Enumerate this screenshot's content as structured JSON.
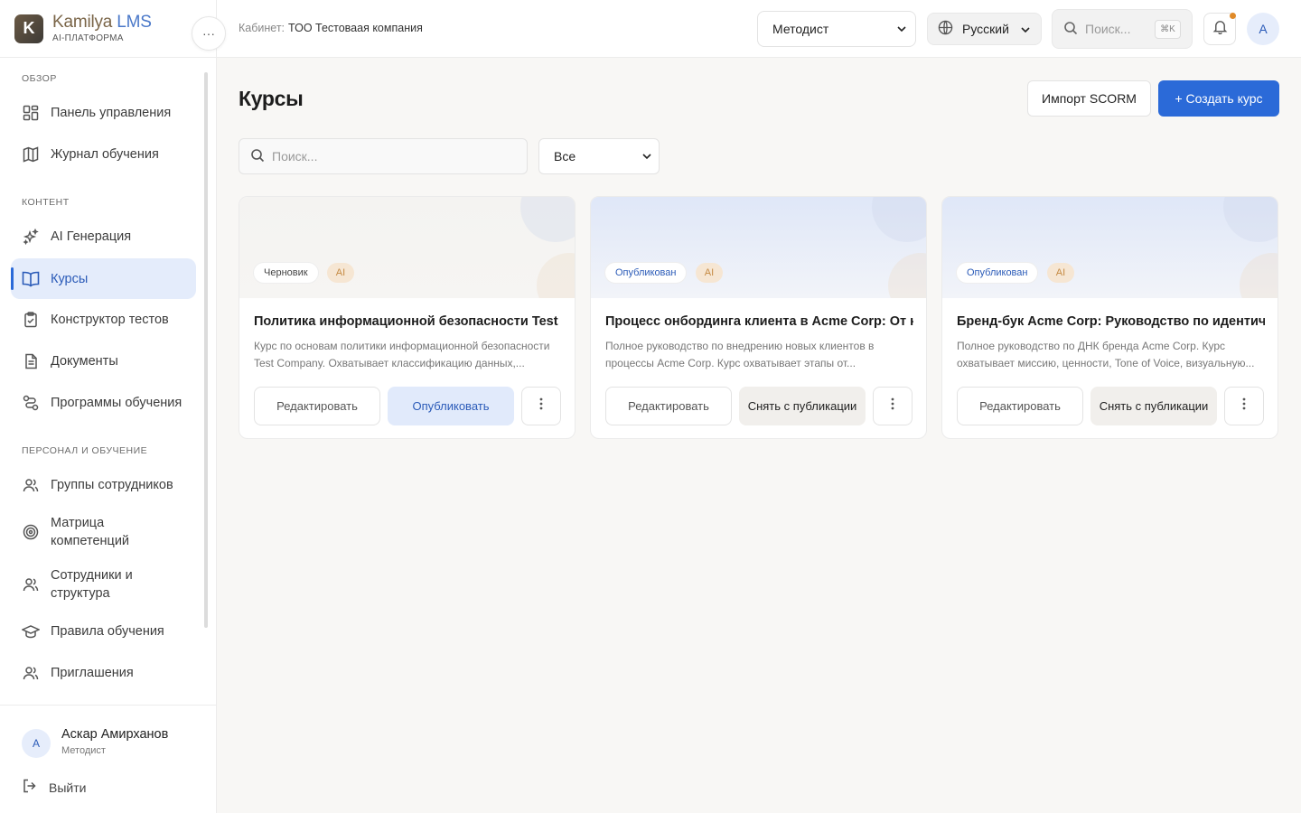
{
  "brand": {
    "logo_letter": "K",
    "name_part1": "Kamilya",
    "name_part2": " LMS",
    "subtitle": "AI-ПЛАТФОРМА"
  },
  "sidebar": {
    "sections": [
      {
        "label": "ОБЗОР"
      },
      {
        "label": "КОНТЕНТ"
      },
      {
        "label": "ПЕРСОНАЛ И ОБУЧЕНИЕ"
      }
    ],
    "items": [
      {
        "label": "Панель управления",
        "icon": "dashboard-icon"
      },
      {
        "label": "Журнал обучения",
        "icon": "map-icon"
      },
      {
        "label": "AI Генерация",
        "icon": "sparkles-icon"
      },
      {
        "label": "Курсы",
        "icon": "book-icon",
        "active": true
      },
      {
        "label": "Конструктор тестов",
        "icon": "clipboard-icon"
      },
      {
        "label": "Документы",
        "icon": "document-icon"
      },
      {
        "label": "Программы обучения",
        "icon": "route-icon"
      },
      {
        "label": "Группы сотрудников",
        "icon": "users-icon"
      },
      {
        "label": "Матрица компетенций",
        "icon": "target-icon"
      },
      {
        "label": "Сотрудники и структура",
        "icon": "users-icon"
      },
      {
        "label": "Правила обучения",
        "icon": "graduation-cap-icon"
      },
      {
        "label": "Приглашения",
        "icon": "users-icon"
      }
    ],
    "more_glyph": "···"
  },
  "user": {
    "initial": "А",
    "name": "Аскар Амирханов",
    "role": "Методист",
    "logout": "Выйти"
  },
  "header": {
    "cabinet_label": "Кабинет:",
    "cabinet_value": "ТОО Тестоваая компания",
    "role": "Методист",
    "language": "Русский",
    "search_placeholder": "Поиск...",
    "shortcut": "⌘K",
    "avatar_initial": "А",
    "notification_dot_color": "#e08a28"
  },
  "main": {
    "title": "Курсы",
    "import_button": "Импорт SCORM",
    "create_button": "+ Создать курс",
    "search_placeholder": "Поиск...",
    "filter_value": "Все"
  },
  "courses": [
    {
      "status": "Черновик",
      "ai_badge": "AI",
      "title": "Политика информационной безопасности Test C",
      "description": "Курс по основам политики информационной безопасности Test Company. Охватывает классификацию данных,...",
      "edit": "Редактировать",
      "action": "Опубликовать"
    },
    {
      "status": "Опубликован",
      "ai_badge": "AI",
      "title": "Процесс онбординга клиента в Acme Corp: От ко",
      "description": "Полное руководство по внедрению новых клиентов в процессы Acme Corp. Курс охватывает этапы от...",
      "edit": "Редактировать",
      "action": "Снять с публикации"
    },
    {
      "status": "Опубликован",
      "ai_badge": "AI",
      "title": "Бренд-бук Acme Corp: Руководство по идентичн",
      "description": "Полное руководство по ДНК бренда Acme Corp. Курс охватывает миссию, ценности, Tone of Voice, визуальную...",
      "edit": "Редактировать",
      "action": "Снять с публикации"
    }
  ],
  "colors": {
    "accent": "#2b6ad8",
    "active_bg": "#e4ecfb",
    "ai_badge_bg": "#f6e6d3"
  }
}
